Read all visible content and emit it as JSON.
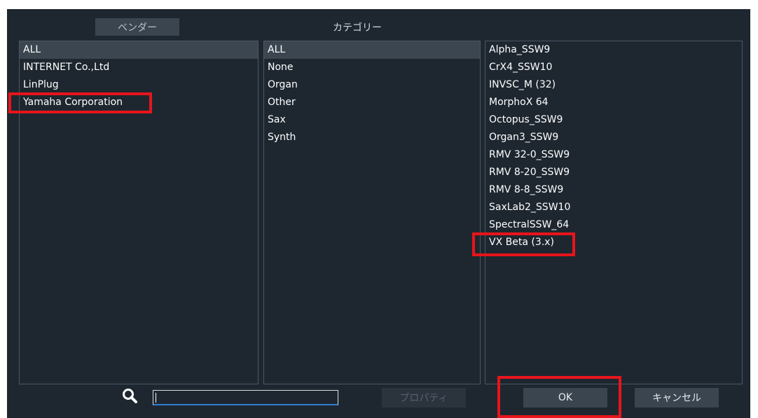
{
  "header": {
    "vendor_button": "ベンダー",
    "category_label": "カテゴリー"
  },
  "vendors": [
    "ALL",
    "INTERNET Co.,Ltd",
    "LinPlug",
    "Yamaha Corporation"
  ],
  "categories": [
    "ALL",
    "None",
    "Organ",
    "Other",
    "Sax",
    "Synth"
  ],
  "plugins": [
    "Alpha_SSW9",
    "CrX4_SSW10",
    "INVSC_M (32)",
    "MorphoX 64",
    "Octopus_SSW9",
    "Organ3_SSW9",
    "RMV 32-0_SSW9",
    "RMV 8-20_SSW9",
    "RMV 8-8_SSW9",
    "SaxLab2_SSW10",
    "SpectralSSW_64",
    "VX Beta (3.x)"
  ],
  "footer": {
    "search_icon": "search-icon",
    "search_value": "",
    "properties_button": "プロパティ",
    "ok_button": "OK",
    "cancel_button": "キャンセル"
  },
  "colors": {
    "background": "#1e2730",
    "selected_row": "#3b4650",
    "highlight": "#e8141b"
  }
}
